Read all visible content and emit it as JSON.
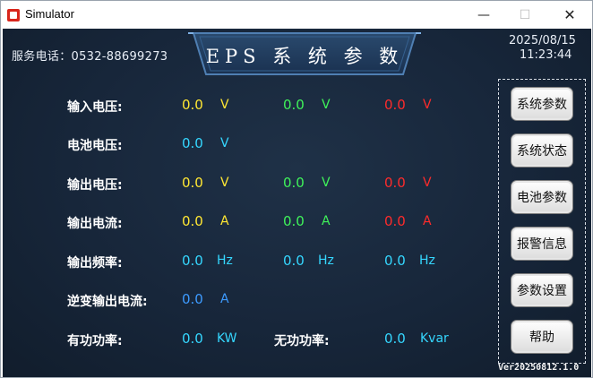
{
  "window": {
    "title": "Simulator",
    "min_glyph": "—",
    "max_glyph": "☐",
    "close_glyph": "✕"
  },
  "header": {
    "hotline": "服务电话：0532-88699273",
    "banner": "EPS 系 统 参 数",
    "date": "2025/08/15",
    "time": "11:23:44"
  },
  "rows": {
    "input_voltage": {
      "label": "输入电压:",
      "v1": "0.0",
      "u1": "V",
      "v2": "0.0",
      "u2": "V",
      "v3": "0.0",
      "u3": "V"
    },
    "battery_voltage": {
      "label": "电池电压:",
      "v1": "0.0",
      "u1": "V"
    },
    "output_voltage": {
      "label": "输出电压:",
      "v1": "0.0",
      "u1": "V",
      "v2": "0.0",
      "u2": "V",
      "v3": "0.0",
      "u3": "V"
    },
    "output_current": {
      "label": "输出电流:",
      "v1": "0.0",
      "u1": "A",
      "v2": "0.0",
      "u2": "A",
      "v3": "0.0",
      "u3": "A"
    },
    "output_frequency": {
      "label": "输出频率:",
      "v1": "0.0",
      "u1": "Hz",
      "v2": "0.0",
      "u2": "Hz",
      "v3": "0.0",
      "u3": "Hz"
    },
    "inverter_current": {
      "label": "逆变输出电流:",
      "v1": "0.0",
      "u1": "A"
    },
    "power": {
      "label": "有功功率:",
      "v1": "0.0",
      "u1": "KW",
      "label2": "无功功率:",
      "v2": "0.0",
      "u2": "Kvar"
    }
  },
  "sidebar": {
    "buttons": [
      "系统参数",
      "系统状态",
      "电池参数",
      "报警信息",
      "参数设置",
      "帮助"
    ]
  },
  "footer": {
    "version": "Ver20250812.1.0"
  },
  "colors": {
    "yellow": "#ffe733",
    "green": "#3ff25a",
    "red": "#ff2b2b",
    "cyan": "#35d7ff",
    "blue": "#3d9bff",
    "background": "#17263a"
  }
}
